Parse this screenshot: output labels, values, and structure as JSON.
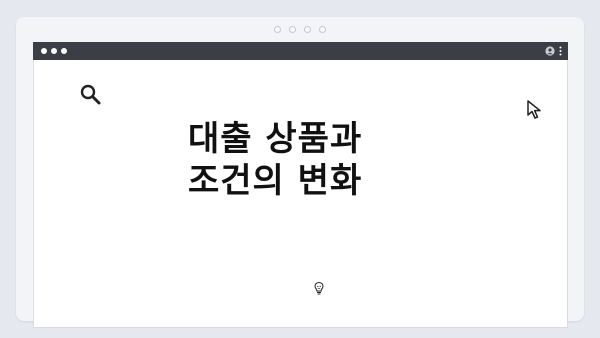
{
  "headline": {
    "line1": "대출 상품과",
    "line2": "조건의 변화"
  },
  "icons": {
    "search": "search-icon",
    "cursor": "cursor-arrow-icon",
    "bulb": "lightbulb-icon",
    "user": "user-icon",
    "menu": "kebab-menu-icon"
  },
  "colors": {
    "page_background": "#e5e9ef",
    "titlebar": "#3b3f45",
    "window_background": "#ffffff",
    "text": "#111111"
  }
}
